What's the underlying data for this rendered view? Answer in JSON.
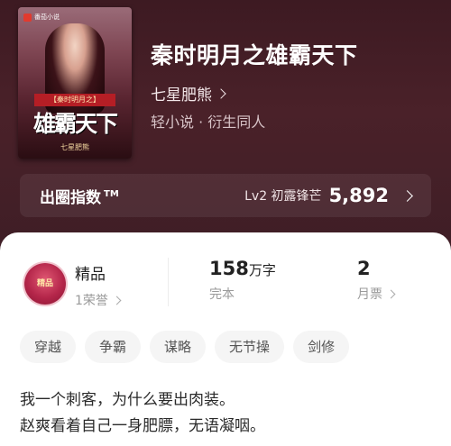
{
  "cover": {
    "app_name": "番茄小说",
    "subtitle": "【秦时明月之】",
    "main_text": "雄霸天下",
    "author": "七星肥熊"
  },
  "book": {
    "title": "秦时明月之雄霸天下",
    "author": "七星肥熊",
    "genre": "轻小说 · 衍生同人"
  },
  "popularity": {
    "label": "出圈指数",
    "tm": "TM",
    "level": "Lv2 初露锋芒",
    "value": "5,892"
  },
  "stats": {
    "badge_text": "精品",
    "quality_label": "精品",
    "honor": "1荣誉",
    "word_count": "158",
    "word_unit": "万字",
    "status": "完本",
    "monthly_tickets": "2",
    "monthly_label": "月票"
  },
  "tags": [
    "穿越",
    "争霸",
    "谋略",
    "无节操",
    "剑修"
  ],
  "intro": {
    "line1": "我一个刺客，为什么要出肉装。",
    "line2": "赵爽看着自己一身肥膘，无语凝咽。"
  },
  "colors": {
    "hero_bg": "#3d1a22",
    "badge": "#b4264a",
    "card_bg": "#ffffff"
  }
}
